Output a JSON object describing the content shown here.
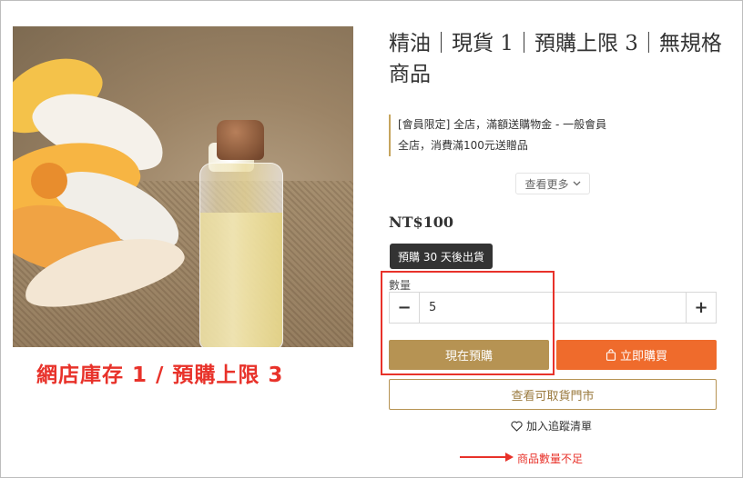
{
  "product": {
    "title": "精油｜現貨 1｜預購上限 3｜無規格商品",
    "image_caption": "網店庫存 1 / 預購上限 3",
    "promotions": [
      "[會員限定] 全店，滿額送購物金 - 一般會員",
      "全店，消費滿100元送贈品"
    ],
    "see_more_label": "查看更多",
    "price": "NT$100",
    "preorder_tag": "預購 30 天後出貨"
  },
  "quantity": {
    "label": "數量",
    "value": "5",
    "decrease_label": "−",
    "increase_label": "+"
  },
  "actions": {
    "preorder_label": "現在預購",
    "buy_now_label": "立即購買",
    "pickup_store_label": "查看可取貨門市",
    "wishlist_label": "加入追蹤清單"
  },
  "annotations": {
    "error_note": "商品數量不足"
  },
  "colors": {
    "accent_gold": "#b69353",
    "buy_orange": "#ef6b2c",
    "annotation_red": "#e8322a"
  },
  "icons": [
    "chevron-down-icon",
    "shopping-bag-icon",
    "heart-icon",
    "arrow-right-icon"
  ]
}
